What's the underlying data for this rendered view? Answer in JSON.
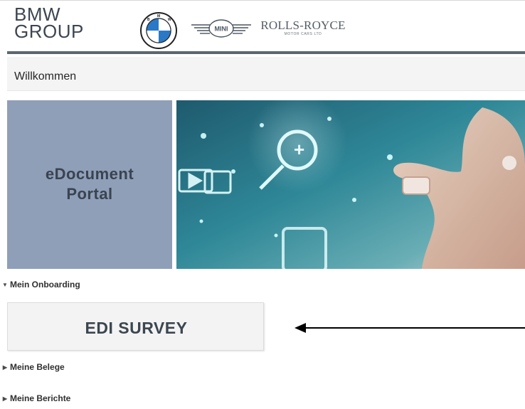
{
  "header": {
    "group_logo_line1": "BMW",
    "group_logo_line2": "GROUP",
    "bmw_logo_text": "BMW",
    "mini_logo_text": "MINI",
    "rolls_royce_name": "ROLLS-ROYCE",
    "rolls_royce_sub": "MOTOR CARS LTD"
  },
  "welcome": {
    "title": "Willkommen"
  },
  "hero": {
    "title_line1": "eDocument",
    "title_line2": "Portal"
  },
  "nav": {
    "onboarding": "Mein Onboarding",
    "survey": "EDI SURVEY",
    "belege": "Meine Belege",
    "berichte": "Meine Berichte"
  },
  "colors": {
    "brand_dark": "#3c4650",
    "hero_panel": "#8f9fb8",
    "header_rule": "#5d6770",
    "bmw_blue": "#2a79c7"
  },
  "icons": [
    "caret-down-icon",
    "caret-right-icon",
    "arrow-left-icon"
  ]
}
